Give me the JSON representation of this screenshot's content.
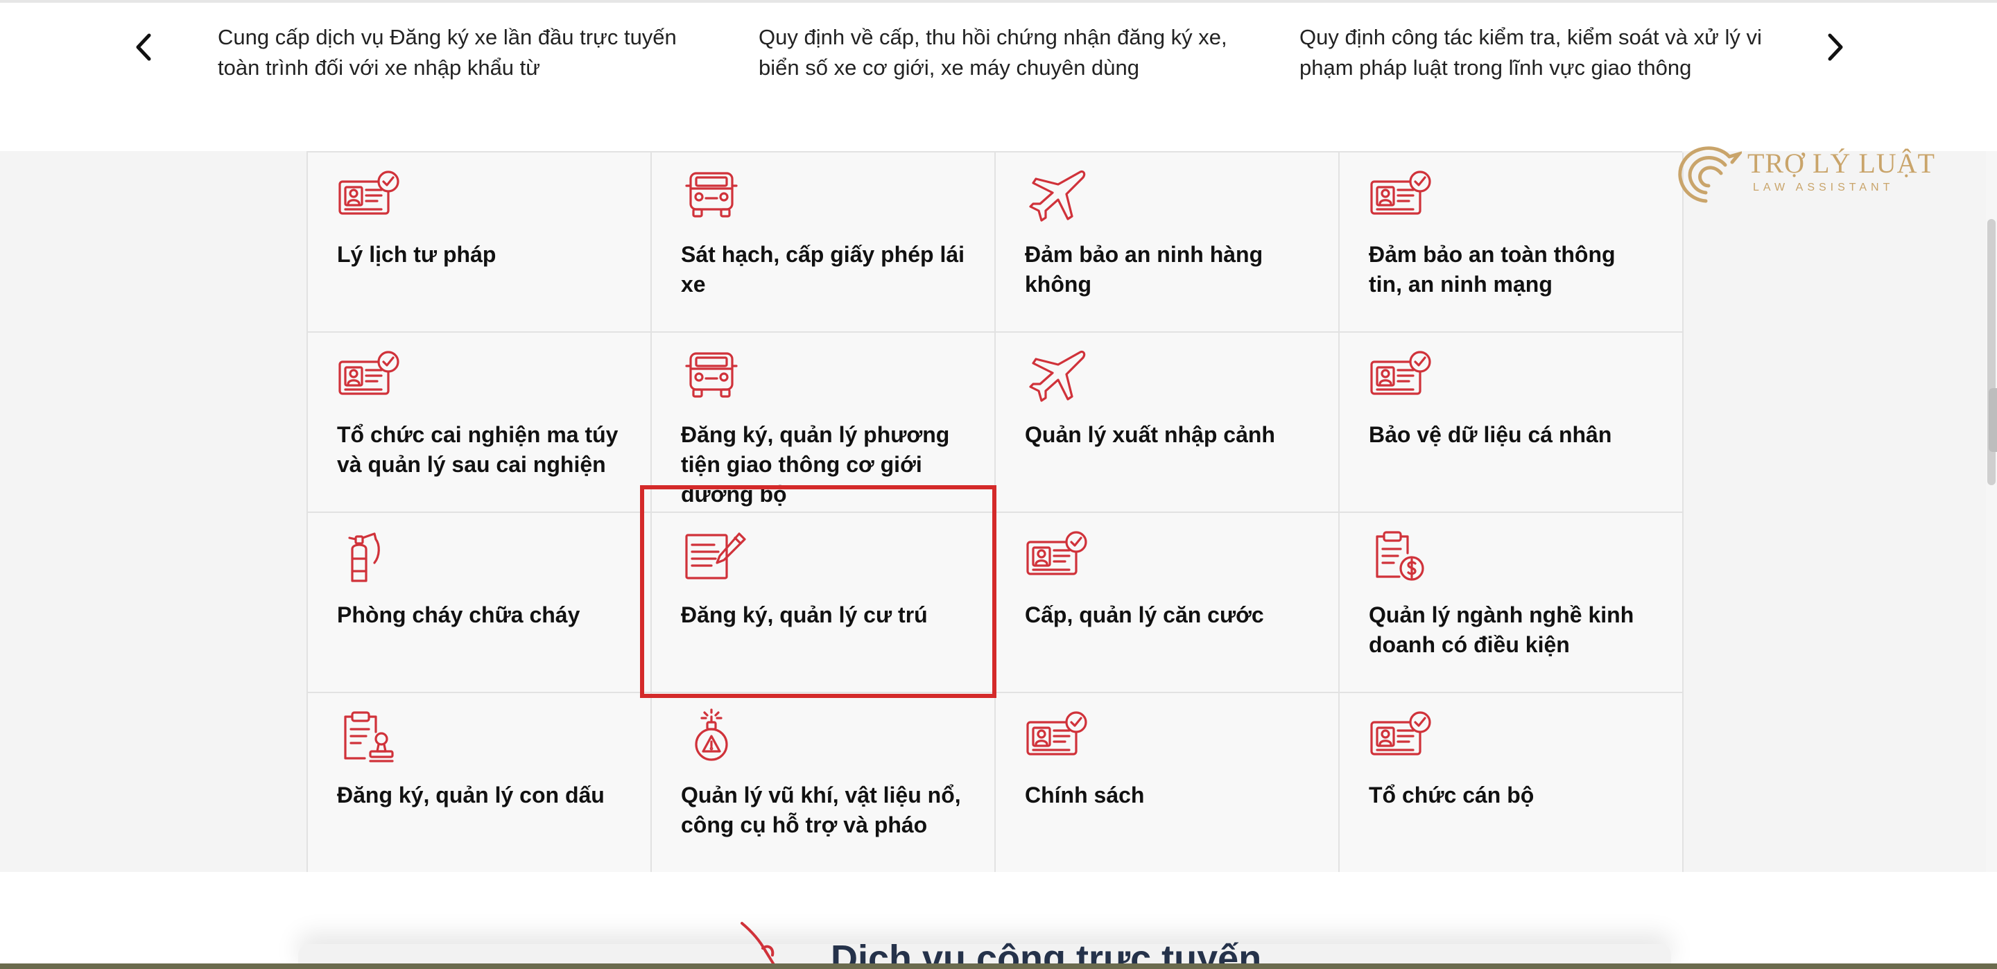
{
  "carousel": {
    "prev_label": "previous",
    "next_label": "next",
    "slides": [
      "Cung cấp dịch vụ Đăng ký xe lần đầu trực tuyến toàn trình đối với xe nhập khẩu từ",
      "Quy định về cấp, thu hồi chứng nhận đăng ký xe, biển số xe cơ giới, xe máy chuyên dùng",
      "Quy định công tác kiểm tra, kiểm soát và xử lý vi phạm pháp luật trong lĩnh vực giao thông"
    ]
  },
  "categories": [
    {
      "label": "Lý lịch tư pháp",
      "icon": "id-card-check-icon"
    },
    {
      "label": "Sát hạch, cấp giấy phép lái xe",
      "icon": "car-icon"
    },
    {
      "label": "Đảm bảo an ninh hàng không",
      "icon": "airplane-icon"
    },
    {
      "label": "Đảm bảo an toàn thông tin, an ninh mạng",
      "icon": "id-card-check-icon"
    },
    {
      "label": "Tổ chức cai nghiện ma túy và quản lý sau cai nghiện",
      "icon": "id-card-check-icon"
    },
    {
      "label": "Đăng ký, quản lý phương tiện giao thông cơ giới đường bộ",
      "icon": "car-icon"
    },
    {
      "label": "Quản lý xuất nhập cảnh",
      "icon": "airplane-icon"
    },
    {
      "label": "Bảo vệ dữ liệu cá nhân",
      "icon": "id-card-check-icon"
    },
    {
      "label": "Phòng cháy chữa cháy",
      "icon": "fire-extinguisher-icon"
    },
    {
      "label": "Đăng ký, quản lý cư trú",
      "icon": "document-pen-icon"
    },
    {
      "label": "Cấp, quản lý căn cước",
      "icon": "id-card-check-icon"
    },
    {
      "label": "Quản lý ngành nghề kinh doanh có điều kiện",
      "icon": "clipboard-dollar-icon"
    },
    {
      "label": "Đăng ký, quản lý con dấu",
      "icon": "clipboard-stamp-icon"
    },
    {
      "label": "Quản lý vũ khí, vật liệu nổ, công cụ hỗ trợ và pháo",
      "icon": "explosive-icon"
    },
    {
      "label": "Chính sách",
      "icon": "id-card-check-icon"
    },
    {
      "label": "Tổ chức cán bộ",
      "icon": "id-card-check-icon"
    }
  ],
  "logo": {
    "brand": "TRỢ LÝ LUẬT",
    "tagline": "LAW ASSISTANT"
  },
  "section": {
    "title": "Dịch vụ công trực tuyến"
  },
  "colors": {
    "icon_red": "#d0323a",
    "highlight_red": "#d42a2a",
    "logo_gold": "#c9a46a",
    "title_navy": "#25324a"
  }
}
